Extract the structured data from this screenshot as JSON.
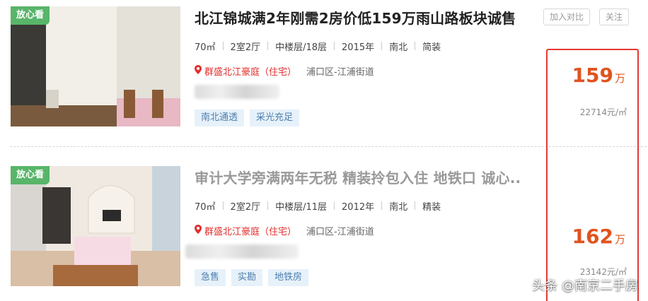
{
  "listings": [
    {
      "badge": "放心看",
      "title": "北江锦城满2年刚需2房价低159万雨山路板块诚售",
      "area": "70㎡",
      "layout": "2室2厅",
      "floor": "中楼层/18层",
      "year": "2015年",
      "orientation": "南北",
      "decoration": "简装",
      "community": "群盛北江豪庭（住宅）",
      "district": "浦口区-江浦街道",
      "tags": [
        "南北通透",
        "采光充足"
      ],
      "price": "159",
      "price_unit": "万",
      "unit_price": "22714元/㎡"
    },
    {
      "badge": "放心看",
      "title": "审计大学旁满两年无税 精装拎包入住 地铁口 诚心..",
      "area": "70㎡",
      "layout": "2室2厅",
      "floor": "中楼层/11层",
      "year": "2012年",
      "orientation": "南北",
      "decoration": "精装",
      "community": "群盛北江豪庭（住宅）",
      "district": "浦口区-江浦街道",
      "tags": [
        "急售",
        "实勘",
        "地铁房"
      ],
      "price": "162",
      "price_unit": "万",
      "unit_price": "23142元/㎡"
    }
  ],
  "buttons": {
    "compare": "加入对比",
    "follow": "关注"
  },
  "watermark": "头条 @南京二手房",
  "colors": {
    "accent": "#e0531f",
    "badge": "#58b56a",
    "highlight": "#e53935",
    "community": "#e0302e",
    "tag_bg": "#e6f1fa"
  },
  "icons": {
    "location": "location-pin-icon"
  }
}
